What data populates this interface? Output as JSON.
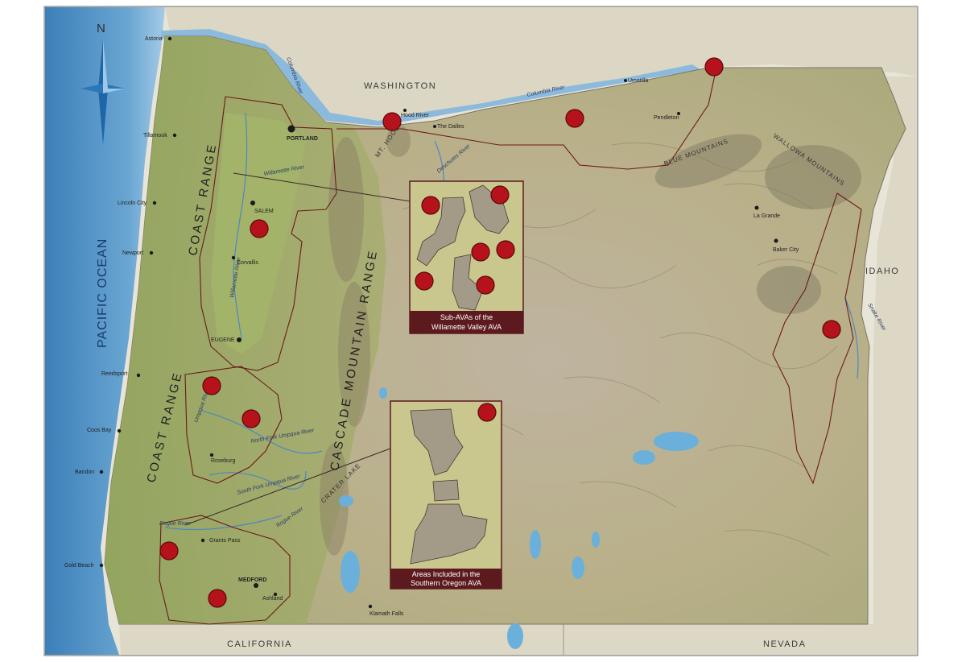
{
  "map": {
    "neighbors": {
      "washington": "WASHINGTON",
      "idaho": "IDAHO",
      "california": "CALIFORNIA",
      "nevada": "NEVADA"
    },
    "ocean": "PACIFIC OCEAN",
    "compass": "N",
    "ranges": {
      "coast_north": "COAST RANGE",
      "coast_south": "COAST RANGE",
      "cascade": "CASCADE MOUNTAIN RANGE",
      "blue": "BLUE MOUNTAINS",
      "wallowa": "WALLOWA MOUNTAINS"
    },
    "peaks": {
      "mt_hood": "MT. HOOD",
      "crater_lake": "CRATER LAKE"
    },
    "rivers": {
      "columbia_1": "Columbia River",
      "columbia_2": "Columbia River",
      "willamette": "Willamette River",
      "willamette_2": "Willamette River",
      "deschutes": "Deschutes River",
      "umpqua": "Umpqua River",
      "north_umpqua": "North Fork Umpqua River",
      "south_umpqua": "South Fork Umpqua River",
      "rogue_1": "Rogue River",
      "rogue_2": "Rogue River",
      "snake": "Snake River"
    },
    "cities": {
      "astoria": "Astoria",
      "tillamook": "Tillamook",
      "lincoln_city": "Lincoln City",
      "newport": "Newport",
      "reedsport": "Reedsport",
      "coos_bay": "Coos Bay",
      "bandon": "Bandon",
      "gold_beach": "Gold Beach",
      "portland": "PORTLAND",
      "salem": "SALEM",
      "corvallis": "Corvallis",
      "eugene": "EUGENE",
      "roseburg": "Roseburg",
      "grants_pass": "Grants Pass",
      "medford": "MEDFORD",
      "ashland": "Ashland",
      "klamath_falls": "Klamath Falls",
      "hood_river": "Hood River",
      "the_dalles": "The Dalles",
      "umatilla": "Umatilla",
      "pendleton": "Pendleton",
      "la_grande": "La Grande",
      "baker_city": "Baker City"
    },
    "inset_willamette": "Sub-AVAs of the Willamette Valley AVA",
    "inset_southern": "Areas Included in the Southern Oregon AVA",
    "colors": {
      "ocean": "#5b9ac9",
      "land": "#b7b07e",
      "valley": "#9fae62",
      "ava_marker": "#b5121b",
      "caption_bg": "#5c1a1e",
      "boundary": "#6b1a1a"
    }
  }
}
